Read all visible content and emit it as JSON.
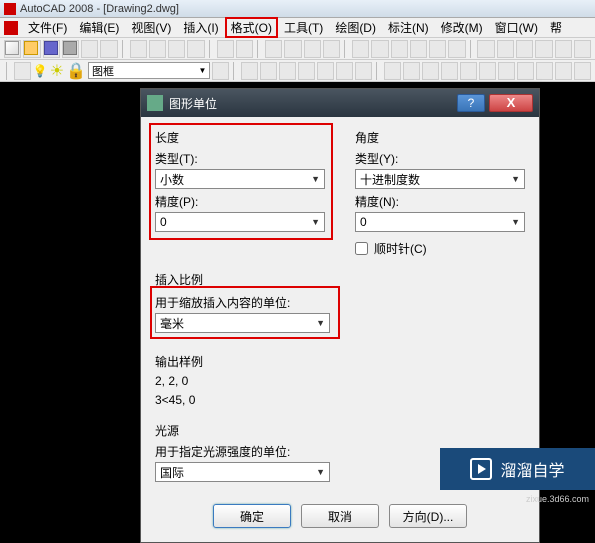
{
  "titlebar": {
    "app": "AutoCAD 2008",
    "doc": "[Drawing2.dwg]"
  },
  "menubar": {
    "file": "文件(F)",
    "edit": "编辑(E)",
    "view": "视图(V)",
    "insert": "插入(I)",
    "format": "格式(O)",
    "tools": "工具(T)",
    "draw": "绘图(D)",
    "dimension": "标注(N)",
    "modify": "修改(M)",
    "window": "窗口(W)",
    "help": "帮"
  },
  "layer_combo": "图框",
  "dialog": {
    "title": "图形单位",
    "length_group": "长度",
    "length_type_label": "类型(T):",
    "length_type_value": "小数",
    "length_precision_label": "精度(P):",
    "length_precision_value": "0",
    "angle_group": "角度",
    "angle_type_label": "类型(Y):",
    "angle_type_value": "十进制度数",
    "angle_precision_label": "精度(N):",
    "angle_precision_value": "0",
    "clockwise_label": "顺时针(C)",
    "insert_scale_group": "插入比例",
    "insert_scale_label": "用于缩放插入内容的单位:",
    "insert_scale_value": "毫米",
    "sample_group": "输出样例",
    "sample_line1": "2, 2, 0",
    "sample_line2": "3<45, 0",
    "light_group": "光源",
    "light_label": "用于指定光源强度的单位:",
    "light_value": "国际",
    "ok": "确定",
    "cancel": "取消",
    "direction": "方向(D)..."
  },
  "watermark": {
    "text": "溜溜自学",
    "sub": "zixue.3d66.com"
  }
}
